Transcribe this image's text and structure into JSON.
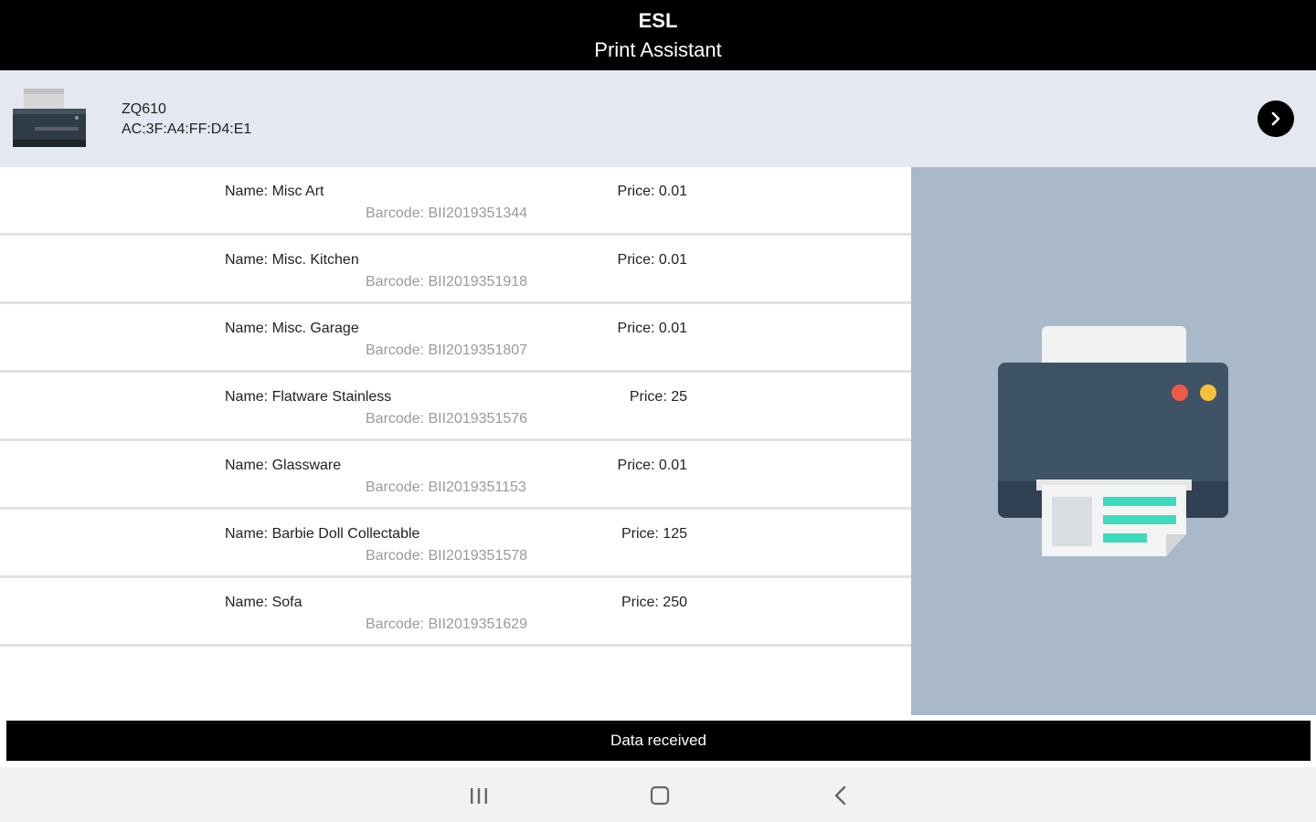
{
  "app_bar": {
    "title": "ESL",
    "subtitle": "Print Assistant"
  },
  "printer": {
    "model": "ZQ610",
    "mac": "AC:3F:A4:FF:D4:E1",
    "icon": "printer-icon",
    "action_icon": "chevron-right-icon"
  },
  "items": [
    {
      "name": "Name: Misc Art",
      "barcode": "Barcode: BII2019351344",
      "price": "Price: 0.01"
    },
    {
      "name": "Name: Misc. Kitchen",
      "barcode": "Barcode: BII2019351918",
      "price": "Price: 0.01"
    },
    {
      "name": "Name: Misc. Garage",
      "barcode": "Barcode: BII2019351807",
      "price": "Price: 0.01"
    },
    {
      "name": "Name: Flatware Stainless",
      "barcode": "Barcode: BII2019351576",
      "price": "Price: 25"
    },
    {
      "name": "Name: Glassware",
      "barcode": "Barcode: BII2019351153",
      "price": "Price: 0.01"
    },
    {
      "name": "Name: Barbie Doll Collectable",
      "barcode": "Barcode: BII2019351578",
      "price": "Price: 125"
    },
    {
      "name": "Name: Sofa",
      "barcode": "Barcode: BII2019351629",
      "price": "Price: 250"
    }
  ],
  "side_panel": {
    "illustration": "printer-illustration-icon"
  },
  "toast": {
    "message": "Data received"
  },
  "nav": {
    "recents": "recents-icon",
    "home": "home-icon",
    "back": "back-icon"
  },
  "colors": {
    "app_bar_bg": "#000000",
    "printer_bar_bg": "#e3e8f1",
    "side_panel_bg": "#a9b9ca",
    "barcode_text": "#9a9a9a",
    "printer_body": "#3f5366",
    "paper_accent": "#3ddbbd",
    "led_red": "#ee5a45",
    "led_yellow": "#f7c23a"
  }
}
